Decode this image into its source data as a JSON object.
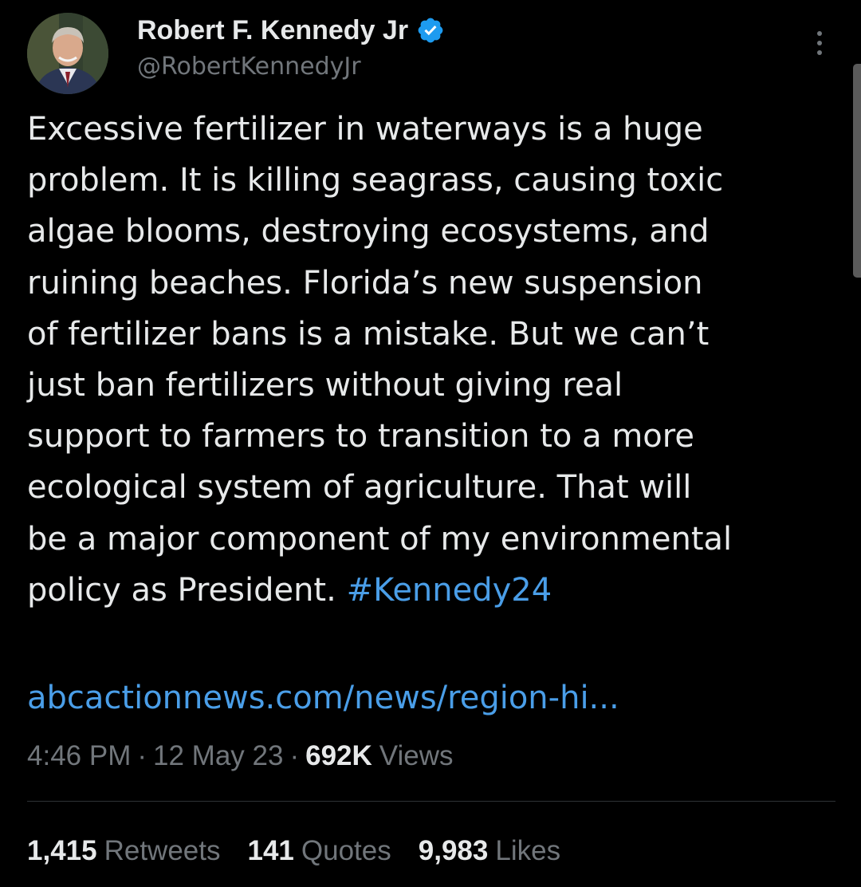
{
  "author": {
    "name": "Robert F. Kennedy Jr",
    "handle": "@RobertKennedyJr",
    "avatar_icon": "profile-photo",
    "verified_icon": "verified-badge-icon",
    "verified_color": "#1d9bf0"
  },
  "tweet": {
    "lines": [
      "Excessive fertilizer in waterways is a huge",
      "problem. It is killing seagrass, causing toxic",
      "algae blooms, destroying ecosystems, and",
      "ruining beaches. Florida’s new suspension",
      "of fertilizer bans is a mistake. But we can’t",
      "just ban fertilizers without giving real",
      "support to farmers to transition to a more",
      "ecological system of agriculture. That will",
      "be a major component of my environmental"
    ],
    "last_line_text": "policy as President.",
    "hashtag": "#Kennedy24",
    "link": "abcactionnews.com/news/region-hi..."
  },
  "meta": {
    "time": "4:46 PM",
    "separator": "·",
    "date": "12 May 23",
    "views_count": "692K",
    "views_label": "Views"
  },
  "stats": {
    "retweets_count": "1,415",
    "retweets_label": "Retweets",
    "quotes_count": "141",
    "quotes_label": "Quotes",
    "likes_count": "9,983",
    "likes_label": "Likes"
  },
  "colors": {
    "background": "#000000",
    "text": "#e7e9ea",
    "secondary": "#71767b",
    "link": "#4a9ee8",
    "divider": "#2f3336"
  },
  "icons": {
    "more": "more-vertical-icon"
  }
}
